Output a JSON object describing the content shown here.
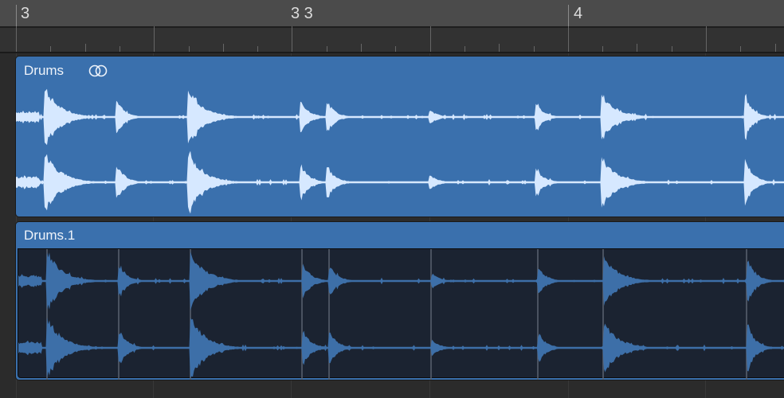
{
  "ruler": {
    "bars": [
      {
        "label": "3"
      },
      {
        "label": "3 3"
      },
      {
        "label": "4"
      }
    ]
  },
  "regions": [
    {
      "name": "Drums",
      "icon": "loop-icon",
      "color": "#3a70ad",
      "wave_color": "#d6e8ff"
    },
    {
      "name": "Drums.1",
      "color": "#3a70ad",
      "body_color": "#1b2331",
      "wave_color": "#3d6fa8"
    }
  ]
}
